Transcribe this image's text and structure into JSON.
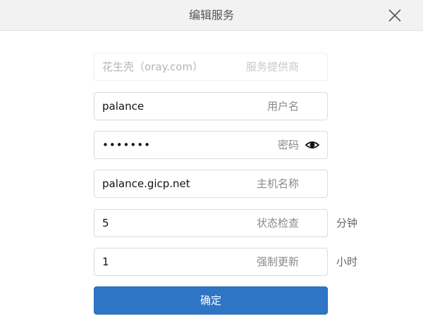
{
  "dialog": {
    "title": "编辑服务"
  },
  "form": {
    "provider": {
      "value": "花生壳（oray.com）",
      "label": "服务提供商"
    },
    "username": {
      "value": "palance",
      "label": "用户名"
    },
    "password": {
      "value": "•••••••",
      "label": "密码",
      "toggle_icon": "eye-icon"
    },
    "hostname": {
      "value": "palance.gicp.net",
      "label": "主机名称"
    },
    "status_check": {
      "value": "5",
      "label": "状态检查",
      "unit": "分钟"
    },
    "force_update": {
      "value": "1",
      "label": "强制更新",
      "unit": "小时"
    }
  },
  "submit_label": "确定",
  "colors": {
    "accent": "#2e75c6",
    "header_bg": "#f2f2f2"
  }
}
